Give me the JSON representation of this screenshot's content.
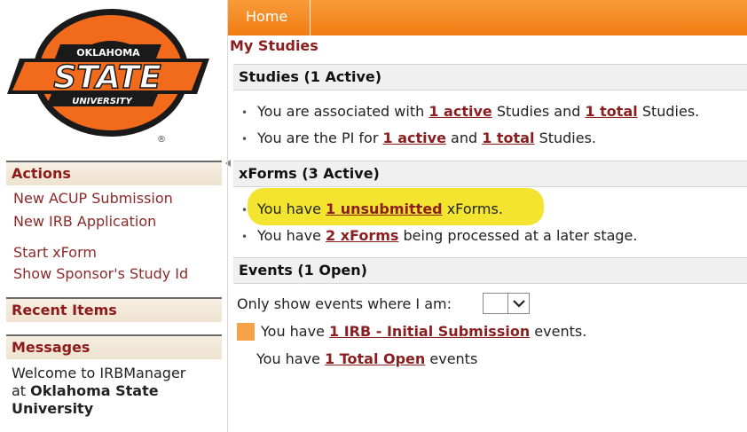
{
  "logo": {
    "line1": "OKLAHOMA",
    "line2": "STATE",
    "line3": "UNIVERSITY",
    "registered": "®"
  },
  "sidebar": {
    "actions_header": "Actions",
    "actions": [
      "New ACUP Submission",
      "New IRB Application",
      "Start xForm",
      "Show Sponsor's Study Id"
    ],
    "recent_header": "Recent Items",
    "messages_header": "Messages",
    "welcome_line1": "Welcome to IRBManager",
    "welcome_at": "at ",
    "welcome_org": "Oklahoma State University"
  },
  "topbar": {
    "home_tab": "Home"
  },
  "page_title": "My Studies",
  "studies": {
    "header": "Studies (1 Active)",
    "row1": {
      "pre": "You are associated with ",
      "link1": "1 active",
      "mid": " Studies and ",
      "link2": "1 total",
      "post": " Studies."
    },
    "row2": {
      "pre": "You are the PI for ",
      "link1": "1 active",
      "mid": " and ",
      "link2": "1 total",
      "post": " Studies."
    }
  },
  "xforms": {
    "header": "xForms (3 Active)",
    "row1": {
      "pre": "You have ",
      "link": "1 unsubmitted",
      "post": " xForms."
    },
    "row2": {
      "pre": "You have ",
      "link": "2 xForms",
      "post": " being processed at a later stage."
    }
  },
  "events": {
    "header": "Events (1 Open)",
    "filter_label": "Only show events where I am:",
    "filter_value": "",
    "row1": {
      "pre": "You have ",
      "link": "1 IRB - Initial Submission",
      "post": " events."
    },
    "row2": {
      "pre": "You have ",
      "link": "1 Total Open",
      "post": " events"
    }
  },
  "colors": {
    "accent_orange": "#f07d12",
    "link_maroon": "#8b1e1e",
    "highlight_yellow": "#f2e218",
    "event_marker": "#f5a24a"
  }
}
